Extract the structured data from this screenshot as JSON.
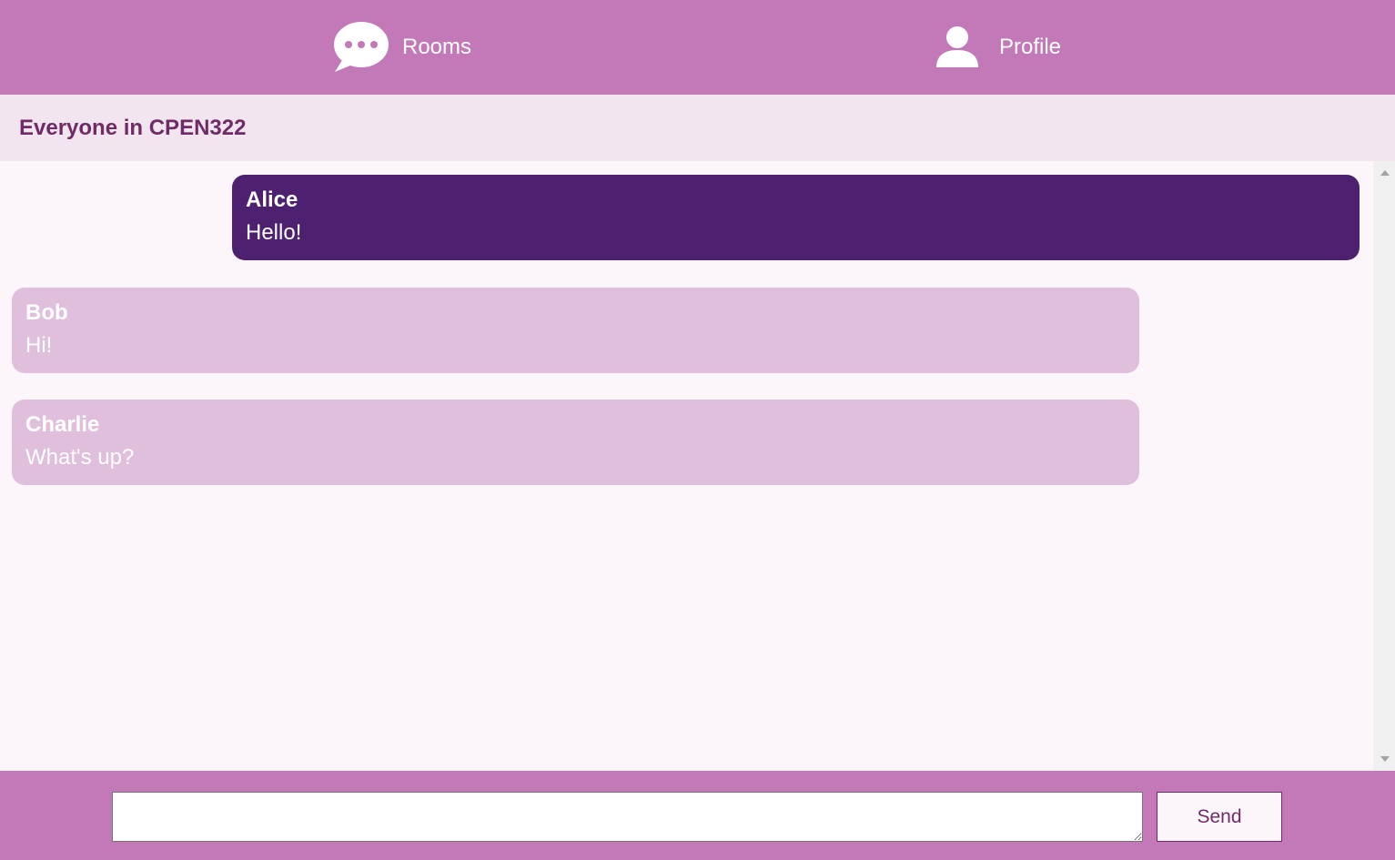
{
  "nav": {
    "rooms_label": "Rooms",
    "rooms_icon": "chat-bubble-icon",
    "profile_label": "Profile",
    "profile_icon": "user-icon"
  },
  "room": {
    "title": "Everyone in CPEN322"
  },
  "messages": [
    {
      "username": "Alice",
      "text": "Hello!",
      "own": true
    },
    {
      "username": "Bob",
      "text": "Hi!",
      "own": false
    },
    {
      "username": "Charlie",
      "text": "What's up?",
      "own": false
    }
  ],
  "composer": {
    "input_value": "",
    "send_label": "Send"
  },
  "colors": {
    "accent": "#c378b8",
    "own_message": "#4e2170",
    "other_message": "#e0bfdc",
    "header_bg": "#f3e5f0",
    "title_text": "#6f2b66"
  }
}
